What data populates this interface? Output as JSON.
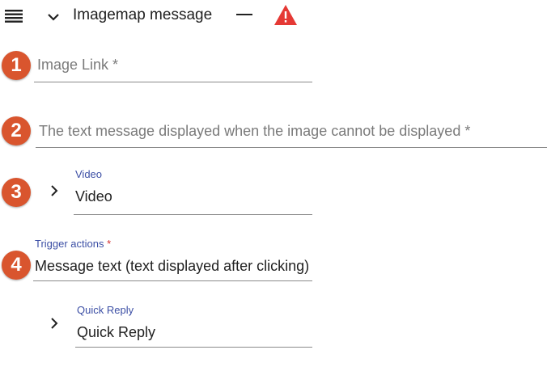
{
  "header": {
    "title": "Imagemap message",
    "warning_color": "#e53935",
    "icons": {
      "drag": "drag-handle-icon",
      "expand": "chevron-down-icon",
      "collapse": "minus-icon",
      "warning": "warning-icon"
    }
  },
  "badges": [
    "1",
    "2",
    "3",
    "4"
  ],
  "badge_color": "#d9552e",
  "fields": {
    "image_link": {
      "placeholder": "Image Link *"
    },
    "alt_text": {
      "placeholder": "The text message displayed when the image cannot be displayed *"
    },
    "video": {
      "label": "Video",
      "value": "Video"
    },
    "trigger_actions": {
      "label": "Trigger actions",
      "required_mark": "*",
      "value": "Message text (text displayed after clicking)"
    },
    "quick_reply": {
      "label": "Quick Reply",
      "value": "Quick Reply"
    }
  },
  "label_color": "#3c4fa5"
}
